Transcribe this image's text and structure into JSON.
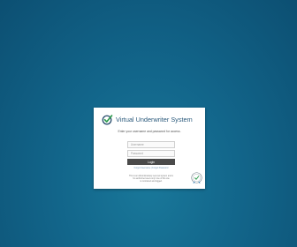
{
  "login": {
    "title": "Virtual Underwriter System",
    "instructions": "Enter your username and password for access.",
    "username_placeholder": "Username",
    "password_placeholder": "Password",
    "login_label": "Login",
    "forgot_username": "Forgot Username",
    "forgot_password": "Forgot Password",
    "link_separator": " | ",
    "notice_line1": "This is an Administratively secured system and is",
    "notice_line2": "for authorized users only. Use of this site",
    "notice_line3": "is monitored and logged."
  },
  "icons": {
    "brand": "check-circle-icon",
    "seal": "security-seal-icon"
  },
  "colors": {
    "background": "#12658a",
    "title": "#2b5a7c",
    "check": "#2e9c4e",
    "button": "#4a4a4a"
  }
}
